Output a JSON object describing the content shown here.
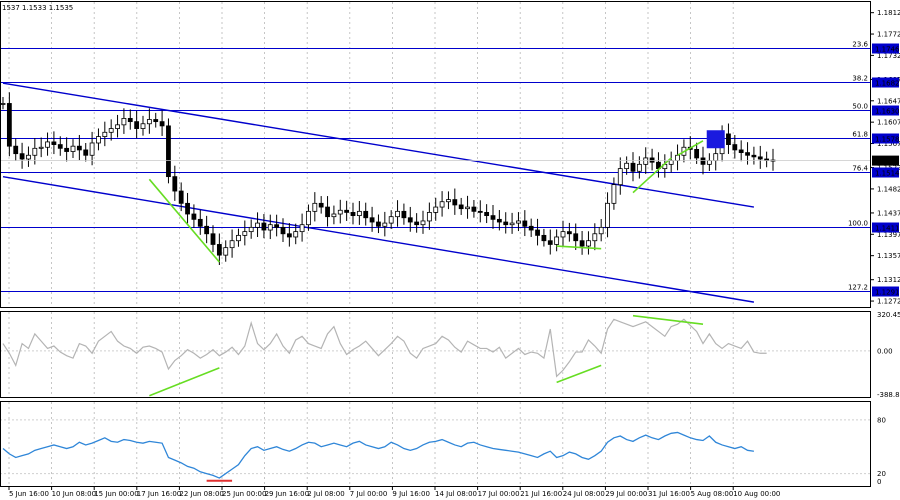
{
  "chart_data": [
    {
      "type": "candlestick",
      "top_label": "1537 1.1533 1.1535",
      "price_ylim": [
        1.1259,
        1.1832
      ],
      "price_ticks": [
        "1.1812",
        "1.1772",
        "1.1732",
        "1.1687",
        "1.1647",
        "1.1607",
        "1.1567",
        "1.1522",
        "1.1482",
        "1.1437",
        "1.1397",
        "1.1357",
        "1.1312",
        "1.1272"
      ],
      "levels": [
        {
          "fib": "23.6",
          "price": 1.1746,
          "label": "1.1746"
        },
        {
          "fib": "38.2",
          "price": 1.1682,
          "label": "1.1682"
        },
        {
          "fib": "50.0",
          "price": 1.163,
          "label": "1.1630"
        },
        {
          "fib": "61.8",
          "price": 1.1578,
          "label": "1.1578"
        },
        {
          "fib": "76.4",
          "price": 1.1514,
          "label": "1.1514"
        },
        {
          "fib": "100.0",
          "price": 1.1411,
          "label": "1.1411"
        },
        {
          "fib": "127.2",
          "price": 1.1291,
          "label": "1.1291"
        }
      ],
      "current_price": {
        "price": 1.1535,
        "label": "1.1535"
      },
      "close_series": [
        1.1642,
        1.1562,
        1.1548,
        1.1538,
        1.1545,
        1.1558,
        1.156,
        1.157,
        1.1565,
        1.1558,
        1.1552,
        1.1562,
        1.1555,
        1.1545,
        1.1568,
        1.158,
        1.1588,
        1.1595,
        1.1602,
        1.1614,
        1.1608,
        1.1595,
        1.1604,
        1.1612,
        1.1608,
        1.16,
        1.1505,
        1.1478,
        1.1455,
        1.1435,
        1.1425,
        1.1412,
        1.1398,
        1.1378,
        1.1358,
        1.1372,
        1.1385,
        1.1395,
        1.1402,
        1.141,
        1.1418,
        1.1405,
        1.1415,
        1.141,
        1.1398,
        1.1392,
        1.1402,
        1.1415,
        1.144,
        1.1455,
        1.1448,
        1.143,
        1.1435,
        1.1442,
        1.1438,
        1.1432,
        1.144,
        1.1428,
        1.142,
        1.1412,
        1.1418,
        1.143,
        1.144,
        1.1428,
        1.142,
        1.1415,
        1.1422,
        1.1438,
        1.1448,
        1.1458,
        1.1462,
        1.1452,
        1.1445,
        1.1448,
        1.144,
        1.1438,
        1.1432,
        1.1425,
        1.142,
        1.1415,
        1.1418,
        1.1422,
        1.1412,
        1.1405,
        1.1395,
        1.1385,
        1.1378,
        1.1392,
        1.1402,
        1.1398,
        1.1385,
        1.1375,
        1.1385,
        1.1398,
        1.141,
        1.1455,
        1.149,
        1.152,
        1.153,
        1.1515,
        1.1528,
        1.154,
        1.1532,
        1.152,
        1.1528,
        1.1535,
        1.1545,
        1.156,
        1.1556,
        1.154,
        1.1528,
        1.1535,
        1.1548,
        1.1585,
        1.1565,
        1.1555,
        1.155,
        1.1545,
        1.1542,
        1.1538,
        1.1535,
        1.1536
      ],
      "channel": [
        {
          "from": [
            0,
            1.168
          ],
          "to": [
            118,
            1.1448
          ]
        },
        {
          "from": [
            0,
            1.1505
          ],
          "to": [
            118,
            1.127
          ]
        }
      ],
      "highlight_box": {
        "index": 112,
        "price": 1.1575
      },
      "divergence_lines": [
        {
          "from": [
            23,
            1.15
          ],
          "to": [
            34,
            1.1345
          ]
        },
        {
          "from": [
            87,
            1.1375
          ],
          "to": [
            94,
            1.137
          ]
        },
        {
          "from": [
            99,
            1.1475
          ],
          "to": [
            105,
            1.154
          ]
        },
        {
          "from": [
            106,
            1.1545
          ],
          "to": [
            110,
            1.1572
          ]
        }
      ]
    },
    {
      "type": "line",
      "ylim": [
        -388.803,
        320.4558
      ],
      "tick_labels": [
        "320.4558",
        "0.00",
        "-388.803"
      ],
      "values": [
        60,
        -20,
        -120,
        60,
        20,
        140,
        80,
        20,
        40,
        -10,
        -40,
        -60,
        60,
        40,
        -20,
        80,
        120,
        160,
        80,
        40,
        20,
        -20,
        30,
        40,
        20,
        -10,
        -150,
        -80,
        -40,
        10,
        -20,
        -60,
        -30,
        10,
        -40,
        -10,
        30,
        -30,
        40,
        230,
        60,
        10,
        60,
        140,
        40,
        -20,
        90,
        120,
        60,
        40,
        20,
        140,
        200,
        60,
        -30,
        10,
        40,
        80,
        20,
        -40,
        10,
        60,
        120,
        80,
        -20,
        -60,
        20,
        40,
        60,
        120,
        90,
        30,
        -10,
        80,
        50,
        20,
        20,
        -10,
        30,
        -60,
        -20,
        20,
        -30,
        -10,
        -20,
        -60,
        180,
        -210,
        -160,
        -90,
        -10,
        -10,
        90,
        40,
        -20,
        180,
        260,
        240,
        220,
        200,
        220,
        240,
        200,
        160,
        120,
        200,
        220,
        260,
        210,
        160,
        60,
        140,
        60,
        20,
        60,
        40,
        20,
        80,
        -10,
        -20,
        -20
      ],
      "divergence_lines": [
        {
          "from": [
            23,
            -370
          ],
          "to": [
            34,
            -140
          ]
        },
        {
          "from": [
            87,
            -260
          ],
          "to": [
            94,
            -120
          ]
        },
        {
          "from": [
            99,
            290
          ],
          "to": [
            110,
            220
          ]
        }
      ]
    },
    {
      "type": "line",
      "ylim": [
        5,
        100
      ],
      "tick_labels": [
        "80",
        "20",
        "0"
      ],
      "levels": [
        80,
        20
      ],
      "values": [
        48,
        42,
        38,
        40,
        42,
        46,
        48,
        50,
        52,
        50,
        48,
        50,
        55,
        52,
        54,
        57,
        60,
        56,
        55,
        58,
        57,
        55,
        54,
        56,
        55,
        54,
        38,
        35,
        32,
        28,
        26,
        22,
        20,
        18,
        15,
        20,
        25,
        30,
        40,
        48,
        50,
        46,
        48,
        50,
        47,
        45,
        48,
        52,
        55,
        54,
        50,
        52,
        54,
        52,
        50,
        54,
        56,
        52,
        50,
        48,
        50,
        55,
        52,
        48,
        46,
        48,
        52,
        55,
        56,
        58,
        55,
        52,
        50,
        54,
        55,
        52,
        50,
        48,
        47,
        46,
        45,
        44,
        42,
        40,
        38,
        42,
        45,
        38,
        40,
        44,
        42,
        38,
        36,
        40,
        45,
        55,
        60,
        62,
        58,
        56,
        60,
        63,
        60,
        58,
        62,
        65,
        66,
        63,
        60,
        58,
        57,
        62,
        55,
        52,
        50,
        48,
        50,
        46,
        45
      ]
    }
  ],
  "x_labels": [
    "5 Jun 16:00",
    "10 Jun 08:00",
    "15 Jun 00:00",
    "17 Jun 16:00",
    "22 Jun 08:00",
    "25 Jun 00:00",
    "29 Jun 16:00",
    "2 Jul 08:00",
    "7 Jul 00:00",
    "9 Jul 16:00",
    "14 Jul 08:00",
    "17 Jul 00:00",
    "21 Jul 16:00",
    "24 Jul 08:00",
    "29 Jul 00:00",
    "31 Jul 16:00",
    "5 Aug 08:00",
    "10 Aug 00:00"
  ],
  "colors": {
    "level": "#0000cc",
    "channel": "#0000cc",
    "divergence": "#66dd22",
    "candle": "#000000",
    "oscillator": "#b4b4b4",
    "rsi": "#2f86d8",
    "current_price_bg": "#000000",
    "highlight": "#1a1adf",
    "marker": "#e03030"
  }
}
